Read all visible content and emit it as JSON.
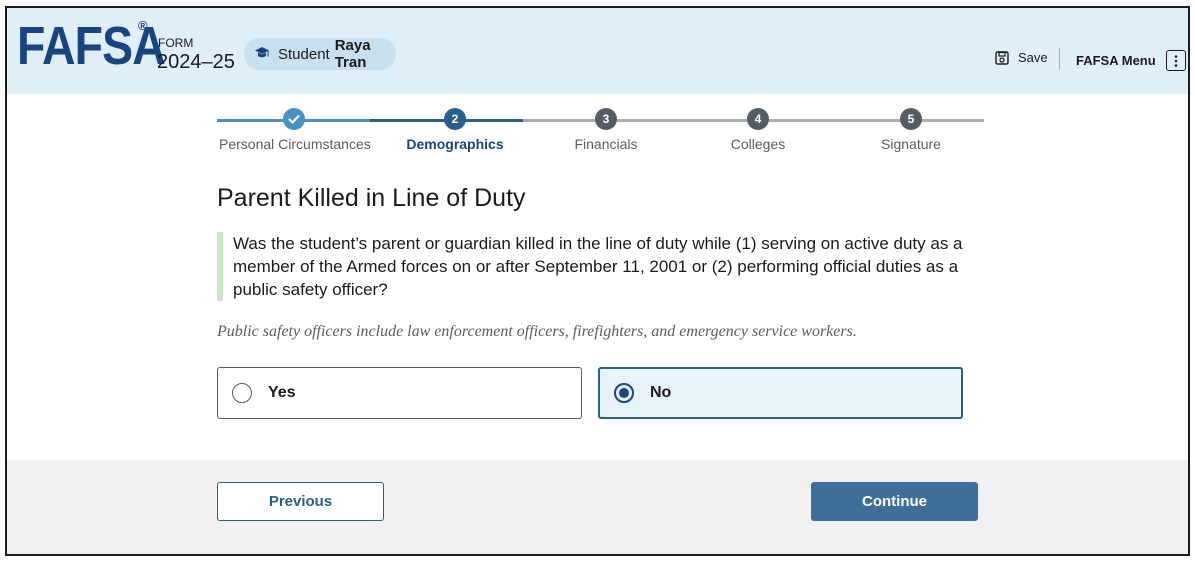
{
  "header": {
    "logo": "FAFSA",
    "logo_mark": "®",
    "form_label": "FORM",
    "form_year": "2024–25",
    "student_prefix": "Student",
    "student_name": "Raya Tran",
    "save_label": "Save",
    "menu_label": "FAFSA Menu",
    "icons": {
      "student": "student-icon",
      "save": "save-icon",
      "menu": "kebab-icon"
    }
  },
  "stepper": {
    "steps": [
      {
        "number": "1",
        "label": "Personal Circumstances",
        "status": "complete"
      },
      {
        "number": "2",
        "label": "Demographics",
        "status": "current"
      },
      {
        "number": "3",
        "label": "Financials",
        "status": "upcoming"
      },
      {
        "number": "4",
        "label": "Colleges",
        "status": "upcoming"
      },
      {
        "number": "5",
        "label": "Signature",
        "status": "upcoming"
      }
    ]
  },
  "main": {
    "title": "Parent Killed in Line of Duty",
    "question": "Was the student’s parent or guardian killed in the line of duty while (1) serving on active duty as a member of the Armed forces on or after September 11, 2001 or (2) performing official duties as a public safety officer?",
    "hint": "Public safety officers include law enforcement officers, firefighters, and emergency service workers.",
    "options": [
      {
        "label": "Yes",
        "selected": false
      },
      {
        "label": "No",
        "selected": true
      }
    ]
  },
  "footer": {
    "previous_label": "Previous",
    "continue_label": "Continue"
  },
  "colors": {
    "header_bg": "#dfeef7",
    "brand_blue": "#1a4480",
    "complete_blue": "#4a90c4",
    "current_blue": "#2a5f8a",
    "upcoming_gray": "#565c65",
    "continue_bg": "#3f6f99",
    "accent_green": "#c7e8c3"
  }
}
